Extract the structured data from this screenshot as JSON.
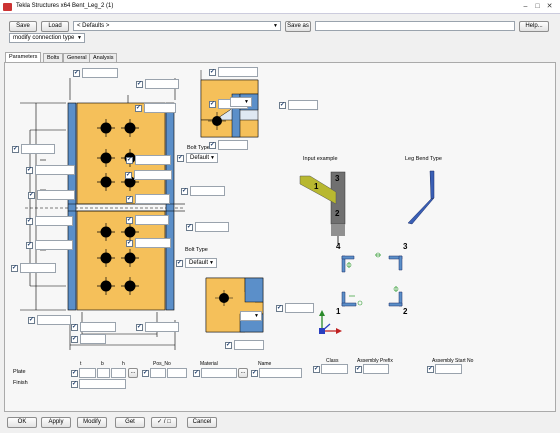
{
  "window": {
    "title": "Tekla Structures x64  Bent_Leg_2 (1)"
  },
  "toolbar": {
    "save_label": "Save",
    "load_label": "Load",
    "preset_value": "< Defaults >",
    "save_as_label": "Save as",
    "save_as_value": "",
    "help_label": "Help...",
    "connection_type": "modify connection type"
  },
  "tabs": [
    {
      "label": "Parameters",
      "active": true
    },
    {
      "label": "Bolts",
      "active": false
    },
    {
      "label": "General",
      "active": false
    },
    {
      "label": "Analysis",
      "active": false
    }
  ],
  "labels": {
    "bolt_type_top": "Bolt Type",
    "bolt_type_top_value": "Default",
    "bolt_type_bottom": "Bolt Type",
    "bolt_type_bottom_value": "Default",
    "input_example": "Input example",
    "leg_bend_type": "Leg Bend Type",
    "example_num_1": "1",
    "example_num_2": "2",
    "example_num_3": "3",
    "leg_num_1": "1",
    "leg_num_2": "2",
    "leg_num_3": "3",
    "leg_num_4": "4"
  },
  "plate_table": {
    "col_t": "t",
    "col_b": "b",
    "col_h": "h",
    "col_pos_no": "Pos_No",
    "col_material": "Material",
    "col_name": "Name",
    "col_class": "Class",
    "col_assembly_prefix": "Assembly Prefix",
    "col_assembly_start_no": "Assembly Start No",
    "row_plate": "Plate",
    "row_finish": "Finish",
    "browse": "..."
  },
  "footer": {
    "ok_label": "OK",
    "apply_label": "Apply",
    "modify_label": "Modify",
    "get_label": "Get",
    "toggle_label": "✓ / □",
    "cancel_label": "Cancel"
  },
  "colors": {
    "plate_fill": "#f5c05a",
    "beam_blue": "#5b8fc9",
    "leg_blue": "#3a5fb5",
    "bolt_black": "#000000",
    "example_yellow": "#b8b830",
    "example_grey": "#707070"
  }
}
